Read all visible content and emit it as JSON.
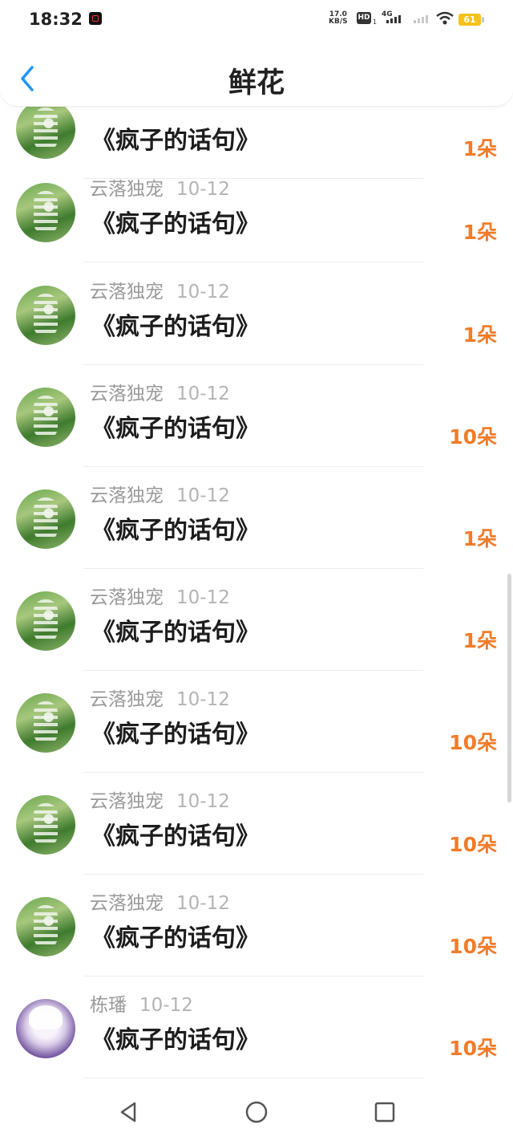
{
  "status": {
    "time": "18:32",
    "net_speed_value": "17.0",
    "net_speed_unit": "KB/S",
    "hd": "HD",
    "hd_sub": "1",
    "signal_type": "4G",
    "battery": "61"
  },
  "header": {
    "title": "鲜花",
    "back_icon": "chevron-left-icon",
    "accent_color": "#2196f3"
  },
  "colors": {
    "count": "#f07c2a",
    "name": "#9a9a9a"
  },
  "rows": [
    {
      "user": "",
      "date": "",
      "work": "《疯子的话句》",
      "count": "1朵",
      "avatar": "skeleton"
    },
    {
      "user": "云落独宠",
      "date": "10-12",
      "work": "《疯子的话句》",
      "count": "1朵",
      "avatar": "skeleton"
    },
    {
      "user": "云落独宠",
      "date": "10-12",
      "work": "《疯子的话句》",
      "count": "1朵",
      "avatar": "skeleton"
    },
    {
      "user": "云落独宠",
      "date": "10-12",
      "work": "《疯子的话句》",
      "count": "10朵",
      "avatar": "skeleton"
    },
    {
      "user": "云落独宠",
      "date": "10-12",
      "work": "《疯子的话句》",
      "count": "1朵",
      "avatar": "skeleton"
    },
    {
      "user": "云落独宠",
      "date": "10-12",
      "work": "《疯子的话句》",
      "count": "1朵",
      "avatar": "skeleton"
    },
    {
      "user": "云落独宠",
      "date": "10-12",
      "work": "《疯子的话句》",
      "count": "10朵",
      "avatar": "skeleton"
    },
    {
      "user": "云落独宠",
      "date": "10-12",
      "work": "《疯子的话句》",
      "count": "10朵",
      "avatar": "skeleton"
    },
    {
      "user": "云落独宠",
      "date": "10-12",
      "work": "《疯子的话句》",
      "count": "10朵",
      "avatar": "skeleton"
    },
    {
      "user": "栋璠",
      "date": "10-12",
      "work": "《疯子的话句》",
      "count": "10朵",
      "avatar": "anime"
    }
  ],
  "navbar": {
    "back": "triangle-back-icon",
    "home": "circle-home-icon",
    "recents": "square-recents-icon"
  }
}
